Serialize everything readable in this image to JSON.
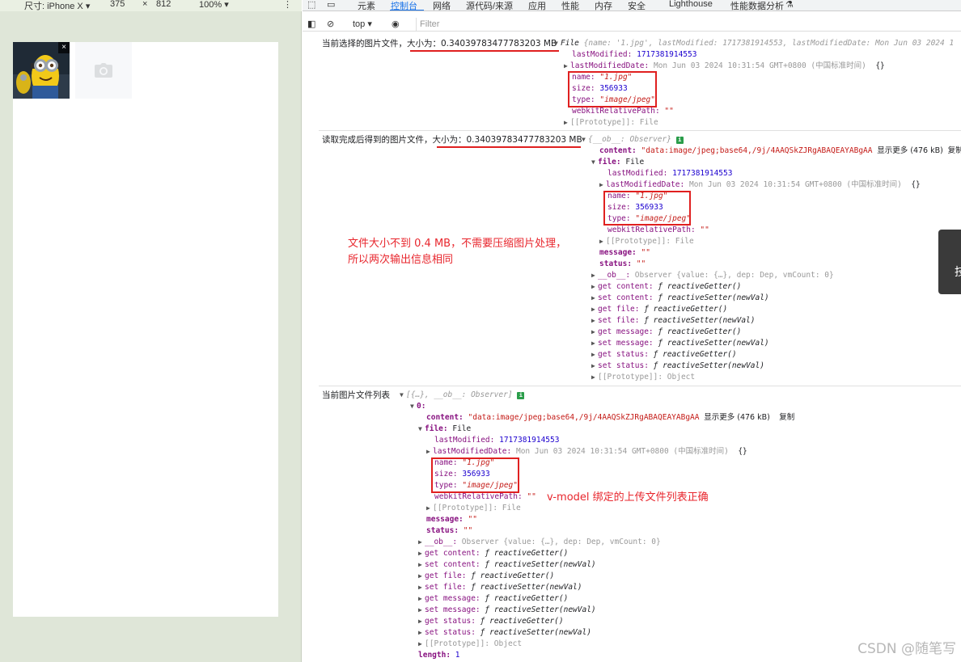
{
  "device_toolbar": {
    "device_label": "尺寸: iPhone X",
    "width": "375",
    "times": "×",
    "height": "812",
    "zoom": "100%",
    "more": "⋮"
  },
  "devtools": {
    "tabs": [
      "元素",
      "控制台",
      "网络",
      "源代码/来源",
      "应用",
      "性能",
      "内存",
      "安全",
      "Lighthouse",
      "性能数据分析"
    ],
    "active_tab": "控制台",
    "console_toolbar": {
      "context": "top",
      "filter_placeholder": "Filter"
    }
  },
  "console": {
    "msg1": {
      "label": "当前选择的图片文件，",
      "size_label": "大小为：0.34039783477783203 MB",
      "summary_type": "File",
      "summary_body": "{name: '1.jpg', lastModified: 1717381914553, lastModifiedDate: Mon Jun 03 2024 1",
      "lastModified_key": "lastModified:",
      "lastModified_val": "1717381914553",
      "lastModifiedDate_key": "lastModifiedDate:",
      "lastModifiedDate_val": "Mon Jun 03 2024 10:31:54 GMT+0800 (中国标准时间)",
      "braces": "{}",
      "name_key": "name:",
      "name_val": "\"1.jpg\"",
      "size_key": "size:",
      "size_val": "356933",
      "type_key": "type:",
      "type_val": "\"image/jpeg\"",
      "webkit_key": "webkitRelativePath:",
      "webkit_val": "\"\"",
      "proto": "[[Prototype]]: File"
    },
    "msg2": {
      "label": "读取完成后得到的图片文件，",
      "size_label": "大小为：0.34039783477783203 MB",
      "summary": "{__ob__: Observer}",
      "content_key": "content:",
      "content_val": "\"data:image/jpeg;base64,/9j/4AAQSkZJRgABAQEAYABgAA",
      "show_more": "显示更多 (476 kB)",
      "copy": "复制",
      "file_key": "file:",
      "file_val": "File",
      "lastModified_key": "lastModified:",
      "lastModified_val": "1717381914553",
      "lastModifiedDate_key": "lastModifiedDate:",
      "lastModifiedDate_val": "Mon Jun 03 2024 10:31:54 GMT+0800 (中国标准时间)",
      "braces": "{}",
      "name_key": "name:",
      "name_val": "\"1.jpg\"",
      "size_key": "size:",
      "size_val": "356933",
      "type_key": "type:",
      "type_val": "\"image/jpeg\"",
      "webkit_key": "webkitRelativePath:",
      "webkit_val": "\"\"",
      "file_proto": "[[Prototype]]: File",
      "message_key": "message:",
      "message_val": "\"\"",
      "status_key": "status:",
      "status_val": "\"\"",
      "ob_key": "__ob__:",
      "ob_val": "Observer  {value: {…}, dep: Dep, vmCount: 0}",
      "accessors": [
        {
          "k": "get content:",
          "v": "ƒ reactiveGetter()"
        },
        {
          "k": "set content:",
          "v": "ƒ reactiveSetter(newVal)"
        },
        {
          "k": "get file:",
          "v": "ƒ reactiveGetter()"
        },
        {
          "k": "set file:",
          "v": "ƒ reactiveSetter(newVal)"
        },
        {
          "k": "get message:",
          "v": "ƒ reactiveGetter()"
        },
        {
          "k": "set message:",
          "v": "ƒ reactiveSetter(newVal)"
        },
        {
          "k": "get status:",
          "v": "ƒ reactiveGetter()"
        },
        {
          "k": "set status:",
          "v": "ƒ reactiveSetter(newVal)"
        }
      ],
      "proto": "[[Prototype]]: Object"
    },
    "msg3": {
      "label": "当前图片文件列表",
      "summary": "[{…}, __ob__: Observer]",
      "index_key": "0:",
      "content_key": "content:",
      "content_val": "\"data:image/jpeg;base64,/9j/4AAQSkZJRgABAQEAYABgAA",
      "show_more": "显示更多 (476 kB)",
      "copy": "复制",
      "file_key": "file:",
      "file_val": "File",
      "lastModified_key": "lastModified:",
      "lastModified_val": "1717381914553",
      "lastModifiedDate_key": "lastModifiedDate:",
      "lastModifiedDate_val": "Mon Jun 03 2024 10:31:54 GMT+0800 (中国标准时间)",
      "braces": "{}",
      "name_key": "name:",
      "name_val": "\"1.jpg\"",
      "size_key": "size:",
      "size_val": "356933",
      "type_key": "type:",
      "type_val": "\"image/jpeg\"",
      "webkit_key": "webkitRelativePath:",
      "webkit_val": "\"\"",
      "file_proto": "[[Prototype]]: File",
      "message_key": "message:",
      "message_val": "\"\"",
      "status_key": "status:",
      "status_val": "\"\"",
      "ob_key": "__ob__:",
      "ob_val": "Observer  {value: {…}, dep: Dep, vmCount: 0}",
      "accessors": [
        {
          "k": "get content:",
          "v": "ƒ reactiveGetter()"
        },
        {
          "k": "set content:",
          "v": "ƒ reactiveSetter(newVal)"
        },
        {
          "k": "get file:",
          "v": "ƒ reactiveGetter()"
        },
        {
          "k": "set file:",
          "v": "ƒ reactiveSetter(newVal)"
        },
        {
          "k": "get message:",
          "v": "ƒ reactiveGetter()"
        },
        {
          "k": "set message:",
          "v": "ƒ reactiveSetter(newVal)"
        },
        {
          "k": "get status:",
          "v": "ƒ reactiveGetter()"
        },
        {
          "k": "set status:",
          "v": "ƒ reactiveSetter(newVal)"
        }
      ],
      "proto": "[[Prototype]]: Object",
      "length_key": "length:",
      "length_val": "1"
    }
  },
  "annotations": {
    "note1_line1": "文件大小不到 0.4 MB，不需要压缩图片处理，",
    "note1_line2": "所以两次输出信息相同",
    "note2": "v-model 绑定的上传文件列表正确"
  },
  "side_widget_text": "技",
  "watermark": "CSDN @随笔写",
  "colors": {
    "accent": "#1a73e8",
    "annotation": "#e8262d",
    "key": "#881280",
    "string": "#c41a16"
  }
}
